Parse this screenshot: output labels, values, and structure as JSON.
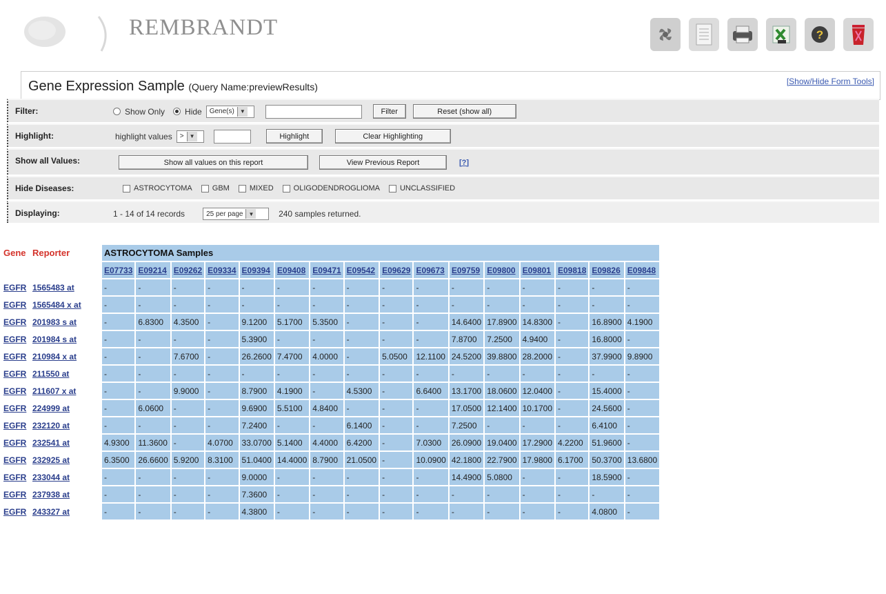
{
  "app": {
    "title": "REMBRANDT"
  },
  "toolbar": {
    "icons": [
      "fan-icon",
      "document-icon",
      "printer-icon",
      "excel-export-icon",
      "help-icon",
      "trash-icon"
    ]
  },
  "panel": {
    "title": "Gene Expression Sample",
    "query": "(Query Name:previewResults)",
    "toggle": "[Show/Hide Form Tools]"
  },
  "filter": {
    "label": "Filter:",
    "show_only": "Show Only",
    "hide": "Hide",
    "selected": "hide",
    "type_value": "Gene(s)",
    "text_value": "",
    "filter_btn": "Filter",
    "reset_btn": "Reset (show all)"
  },
  "highlight": {
    "label": "Highlight:",
    "text": "highlight values",
    "op": ">",
    "value": "",
    "highlight_btn": "Highlight",
    "clear_btn": "Clear Highlighting"
  },
  "show_all": {
    "label": "Show all Values:",
    "show_btn": "Show all values on this report",
    "prev_btn": "View Previous Report",
    "help": "[?]"
  },
  "hide_diseases": {
    "label": "Hide Diseases:",
    "items": [
      "ASTROCYTOMA",
      "GBM",
      "MIXED",
      "OLIGODENDROGLIOMA",
      "UNCLASSIFIED"
    ]
  },
  "displaying": {
    "label": "Displaying:",
    "records": "1 - 14 of 14 records",
    "per_page": "25 per page",
    "returned": "240 samples returned."
  },
  "table": {
    "gene_header": "Gene",
    "reporter_header": "Reporter",
    "group_header": "ASTROCYTOMA Samples",
    "samples": [
      "E07733",
      "E09214",
      "E09262",
      "E09334",
      "E09394",
      "E09408",
      "E09471",
      "E09542",
      "E09629",
      "E09673",
      "E09759",
      "E09800",
      "E09801",
      "E09818",
      "E09826",
      "E09848"
    ],
    "rows": [
      {
        "gene": "EGFR",
        "reporter": "1565483_at",
        "values": [
          "-",
          "-",
          "-",
          "-",
          "-",
          "-",
          "-",
          "-",
          "-",
          "-",
          "-",
          "-",
          "-",
          "-",
          "-",
          "-"
        ]
      },
      {
        "gene": "EGFR",
        "reporter": "1565484_x_at",
        "values": [
          "-",
          "-",
          "-",
          "-",
          "-",
          "-",
          "-",
          "-",
          "-",
          "-",
          "-",
          "-",
          "-",
          "-",
          "-",
          "-"
        ]
      },
      {
        "gene": "EGFR",
        "reporter": "201983_s_at",
        "values": [
          "-",
          "6.8300",
          "4.3500",
          "-",
          "9.1200",
          "5.1700",
          "5.3500",
          "-",
          "-",
          "-",
          "14.6400",
          "17.8900",
          "14.8300",
          "-",
          "16.8900",
          "4.1900"
        ]
      },
      {
        "gene": "EGFR",
        "reporter": "201984_s_at",
        "values": [
          "-",
          "-",
          "-",
          "-",
          "5.3900",
          "-",
          "-",
          "-",
          "-",
          "-",
          "7.8700",
          "7.2500",
          "4.9400",
          "-",
          "16.8000",
          "-"
        ]
      },
      {
        "gene": "EGFR",
        "reporter": "210984_x_at",
        "values": [
          "-",
          "-",
          "7.6700",
          "-",
          "26.2600",
          "7.4700",
          "4.0000",
          "-",
          "5.0500",
          "12.1100",
          "24.5200",
          "39.8800",
          "28.2000",
          "-",
          "37.9900",
          "9.8900"
        ]
      },
      {
        "gene": "EGFR",
        "reporter": "211550_at",
        "values": [
          "-",
          "-",
          "-",
          "-",
          "-",
          "-",
          "-",
          "-",
          "-",
          "-",
          "-",
          "-",
          "-",
          "-",
          "-",
          "-"
        ]
      },
      {
        "gene": "EGFR",
        "reporter": "211607_x_at",
        "values": [
          "-",
          "-",
          "9.9000",
          "-",
          "8.7900",
          "4.1900",
          "-",
          "4.5300",
          "-",
          "6.6400",
          "13.1700",
          "18.0600",
          "12.0400",
          "-",
          "15.4000",
          "-"
        ]
      },
      {
        "gene": "EGFR",
        "reporter": "224999_at",
        "values": [
          "-",
          "6.0600",
          "-",
          "-",
          "9.6900",
          "5.5100",
          "4.8400",
          "-",
          "-",
          "-",
          "17.0500",
          "12.1400",
          "10.1700",
          "-",
          "24.5600",
          "-"
        ]
      },
      {
        "gene": "EGFR",
        "reporter": "232120_at",
        "values": [
          "-",
          "-",
          "-",
          "-",
          "7.2400",
          "-",
          "-",
          "6.1400",
          "-",
          "-",
          "7.2500",
          "-",
          "-",
          "-",
          "6.4100",
          "-"
        ]
      },
      {
        "gene": "EGFR",
        "reporter": "232541_at",
        "values": [
          "4.9300",
          "11.3600",
          "-",
          "4.0700",
          "33.0700",
          "5.1400",
          "4.4000",
          "6.4200",
          "-",
          "7.0300",
          "26.0900",
          "19.0400",
          "17.2900",
          "4.2200",
          "51.9600",
          "-"
        ]
      },
      {
        "gene": "EGFR",
        "reporter": "232925_at",
        "values": [
          "6.3500",
          "26.6600",
          "5.9200",
          "8.3100",
          "51.0400",
          "14.4000",
          "8.7900",
          "21.0500",
          "-",
          "10.0900",
          "42.1800",
          "22.7900",
          "17.9800",
          "6.1700",
          "50.3700",
          "13.6800"
        ]
      },
      {
        "gene": "EGFR",
        "reporter": "233044_at",
        "values": [
          "-",
          "-",
          "-",
          "-",
          "9.0000",
          "-",
          "-",
          "-",
          "-",
          "-",
          "14.4900",
          "5.0800",
          "-",
          "-",
          "18.5900",
          "-"
        ]
      },
      {
        "gene": "EGFR",
        "reporter": "237938_at",
        "values": [
          "-",
          "-",
          "-",
          "-",
          "7.3600",
          "-",
          "-",
          "-",
          "-",
          "-",
          "-",
          "-",
          "-",
          "-",
          "-",
          "-"
        ]
      },
      {
        "gene": "EGFR",
        "reporter": "243327_at",
        "values": [
          "-",
          "-",
          "-",
          "-",
          "4.3800",
          "-",
          "-",
          "-",
          "-",
          "-",
          "-",
          "-",
          "-",
          "-",
          "4.0800",
          "-"
        ]
      }
    ]
  }
}
